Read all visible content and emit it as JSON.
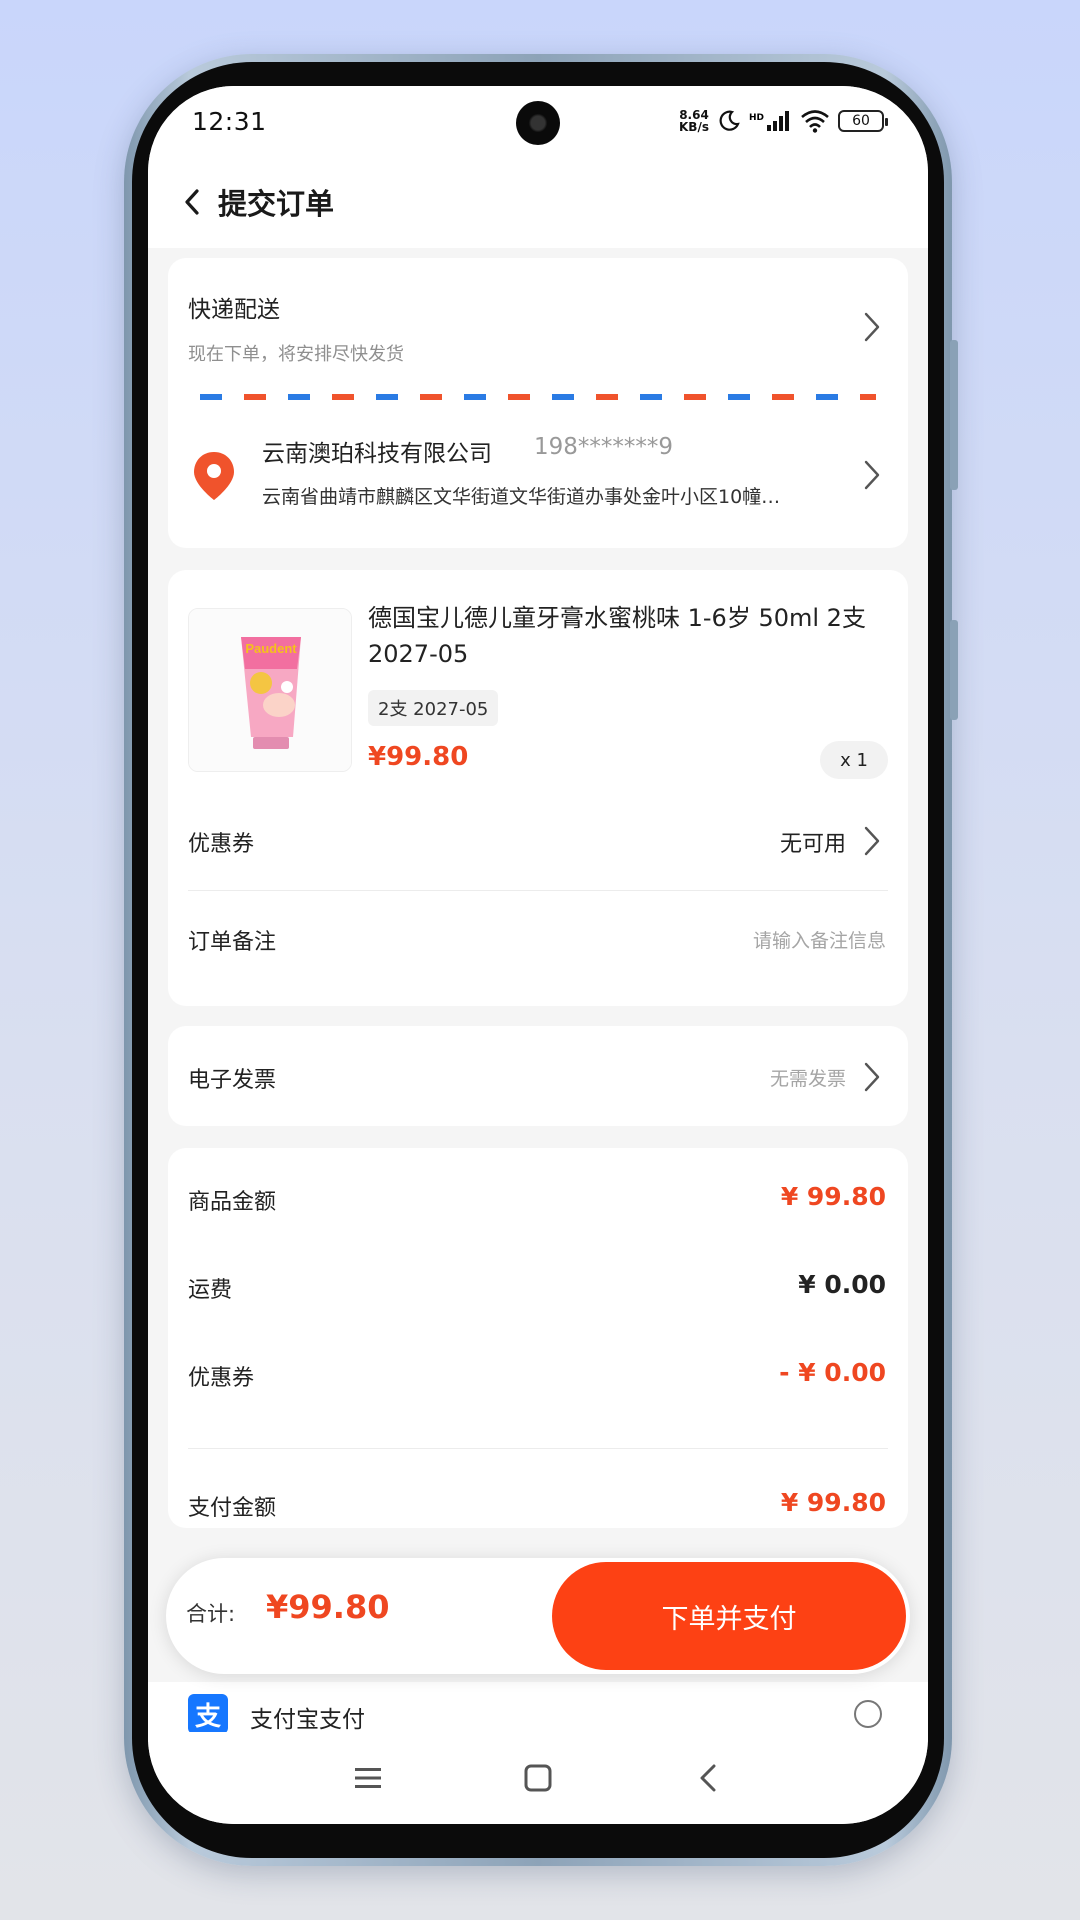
{
  "status_bar": {
    "time": "12:31",
    "net_speed_value": "8.64",
    "net_speed_unit": "KB/s",
    "hd_label": "HD",
    "battery": "60"
  },
  "header": {
    "title": "提交订单"
  },
  "delivery": {
    "title": "快递配送",
    "subtitle": "现在下单，将安排尽快发货"
  },
  "address": {
    "name": "云南澳珀科技有限公司",
    "phone": "198*******9",
    "detail": "云南省曲靖市麒麟区文华街道文华街道办事处金叶小区10幢…"
  },
  "product": {
    "name": "德国宝儿德儿童牙膏水蜜桃味 1-6岁 50ml 2支 2027-05",
    "spec": "2支 2027-05",
    "price": "¥99.80",
    "quantity": "x 1",
    "image_brand_text": "Paudent"
  },
  "coupon": {
    "label": "优惠券",
    "value": "无可用"
  },
  "remark": {
    "label": "订单备注",
    "placeholder": "请输入备注信息"
  },
  "invoice": {
    "label": "电子发票",
    "value": "无需发票"
  },
  "summary": {
    "goods_label": "商品金额",
    "goods_value": "¥ 99.80",
    "shipping_label": "运费",
    "shipping_value": "¥ 0.00",
    "coupon_label": "优惠券",
    "coupon_value": "- ¥ 0.00",
    "pay_label": "支付金额",
    "pay_value": "¥ 99.80"
  },
  "bottom_bar": {
    "total_label": "合计:",
    "total_amount": "¥99.80",
    "pay_button": "下单并支付"
  },
  "payment_method": {
    "label": "支付宝支付",
    "icon_char": "支"
  },
  "colors": {
    "accent": "#ef4721",
    "button": "#fd4114",
    "alipay": "#1677ff"
  },
  "icons": [
    "back-chevron-icon",
    "chevron-right-icon",
    "location-pin-icon",
    "alipay-icon",
    "menu-icon",
    "home-icon",
    "back-icon",
    "wifi-icon",
    "signal-icon",
    "moon-icon"
  ]
}
